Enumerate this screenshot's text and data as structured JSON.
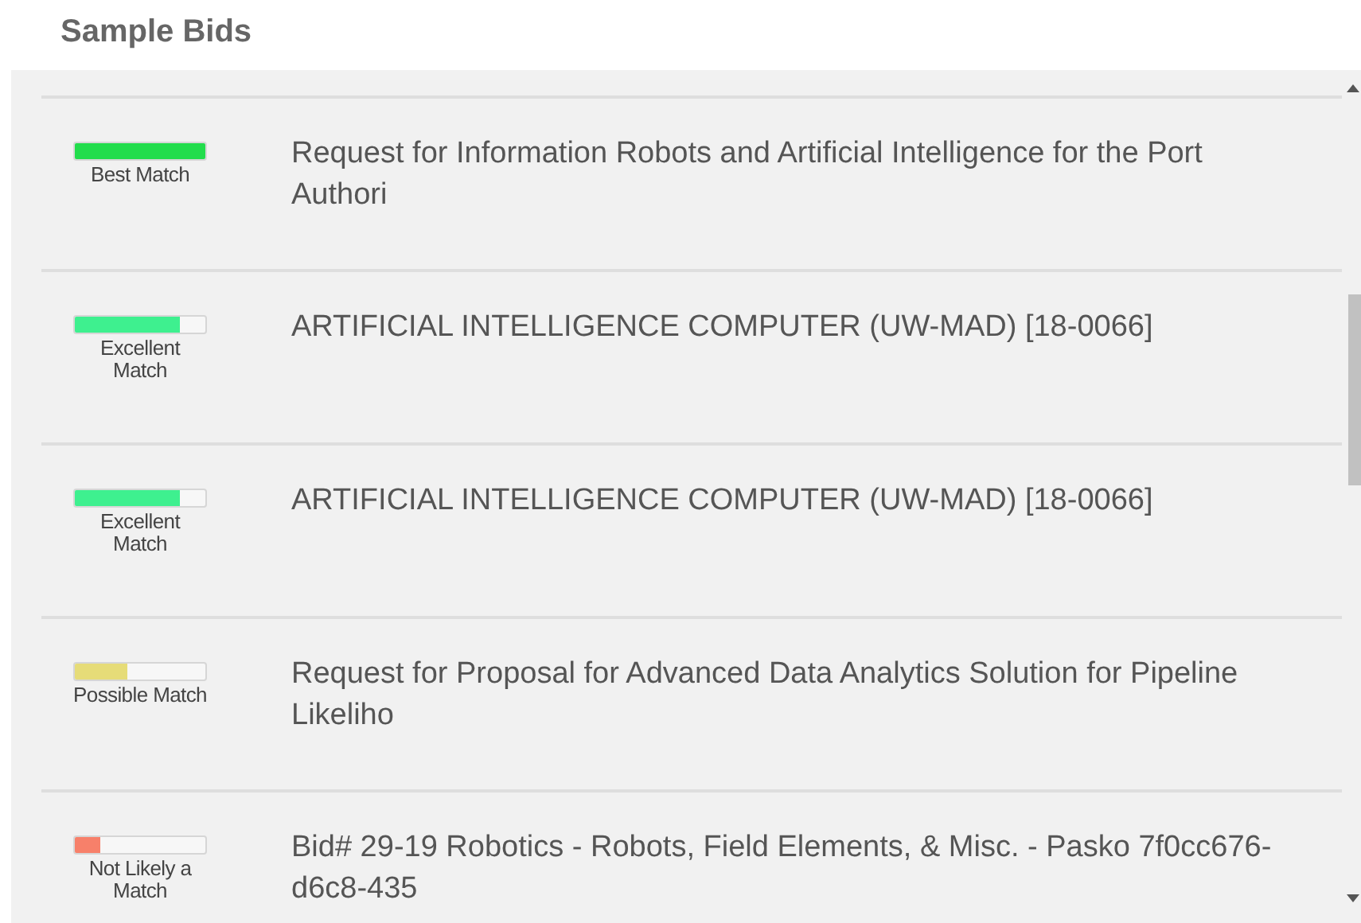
{
  "title": "Sample Bids",
  "bids": [
    {
      "match": "Best Match",
      "level": 1.0,
      "color": "#22dd4c",
      "title": "Request for Information Robots and Artificial Intelligence for the Port Authori"
    },
    {
      "match": "Excellent Match",
      "level": 0.8,
      "color": "#3ef08f",
      "title": "ARTIFICIAL INTELLIGENCE COMPUTER (UW-MAD) [18-0066]"
    },
    {
      "match": "Excellent Match",
      "level": 0.8,
      "color": "#3ef08f",
      "title": "ARTIFICIAL INTELLIGENCE COMPUTER (UW-MAD) [18-0066]"
    },
    {
      "match": "Possible Match",
      "level": 0.4,
      "color": "#e6dc78",
      "title": "Request for Proposal for Advanced Data Analytics Solution for Pipeline Likeliho"
    },
    {
      "match": "Not Likely a Match",
      "level": 0.2,
      "color": "#f7806a",
      "title": "Bid# 29-19 Robotics - Robots, Field Elements, & Misc. - Pasko 7f0cc676-d6c8-435"
    }
  ]
}
